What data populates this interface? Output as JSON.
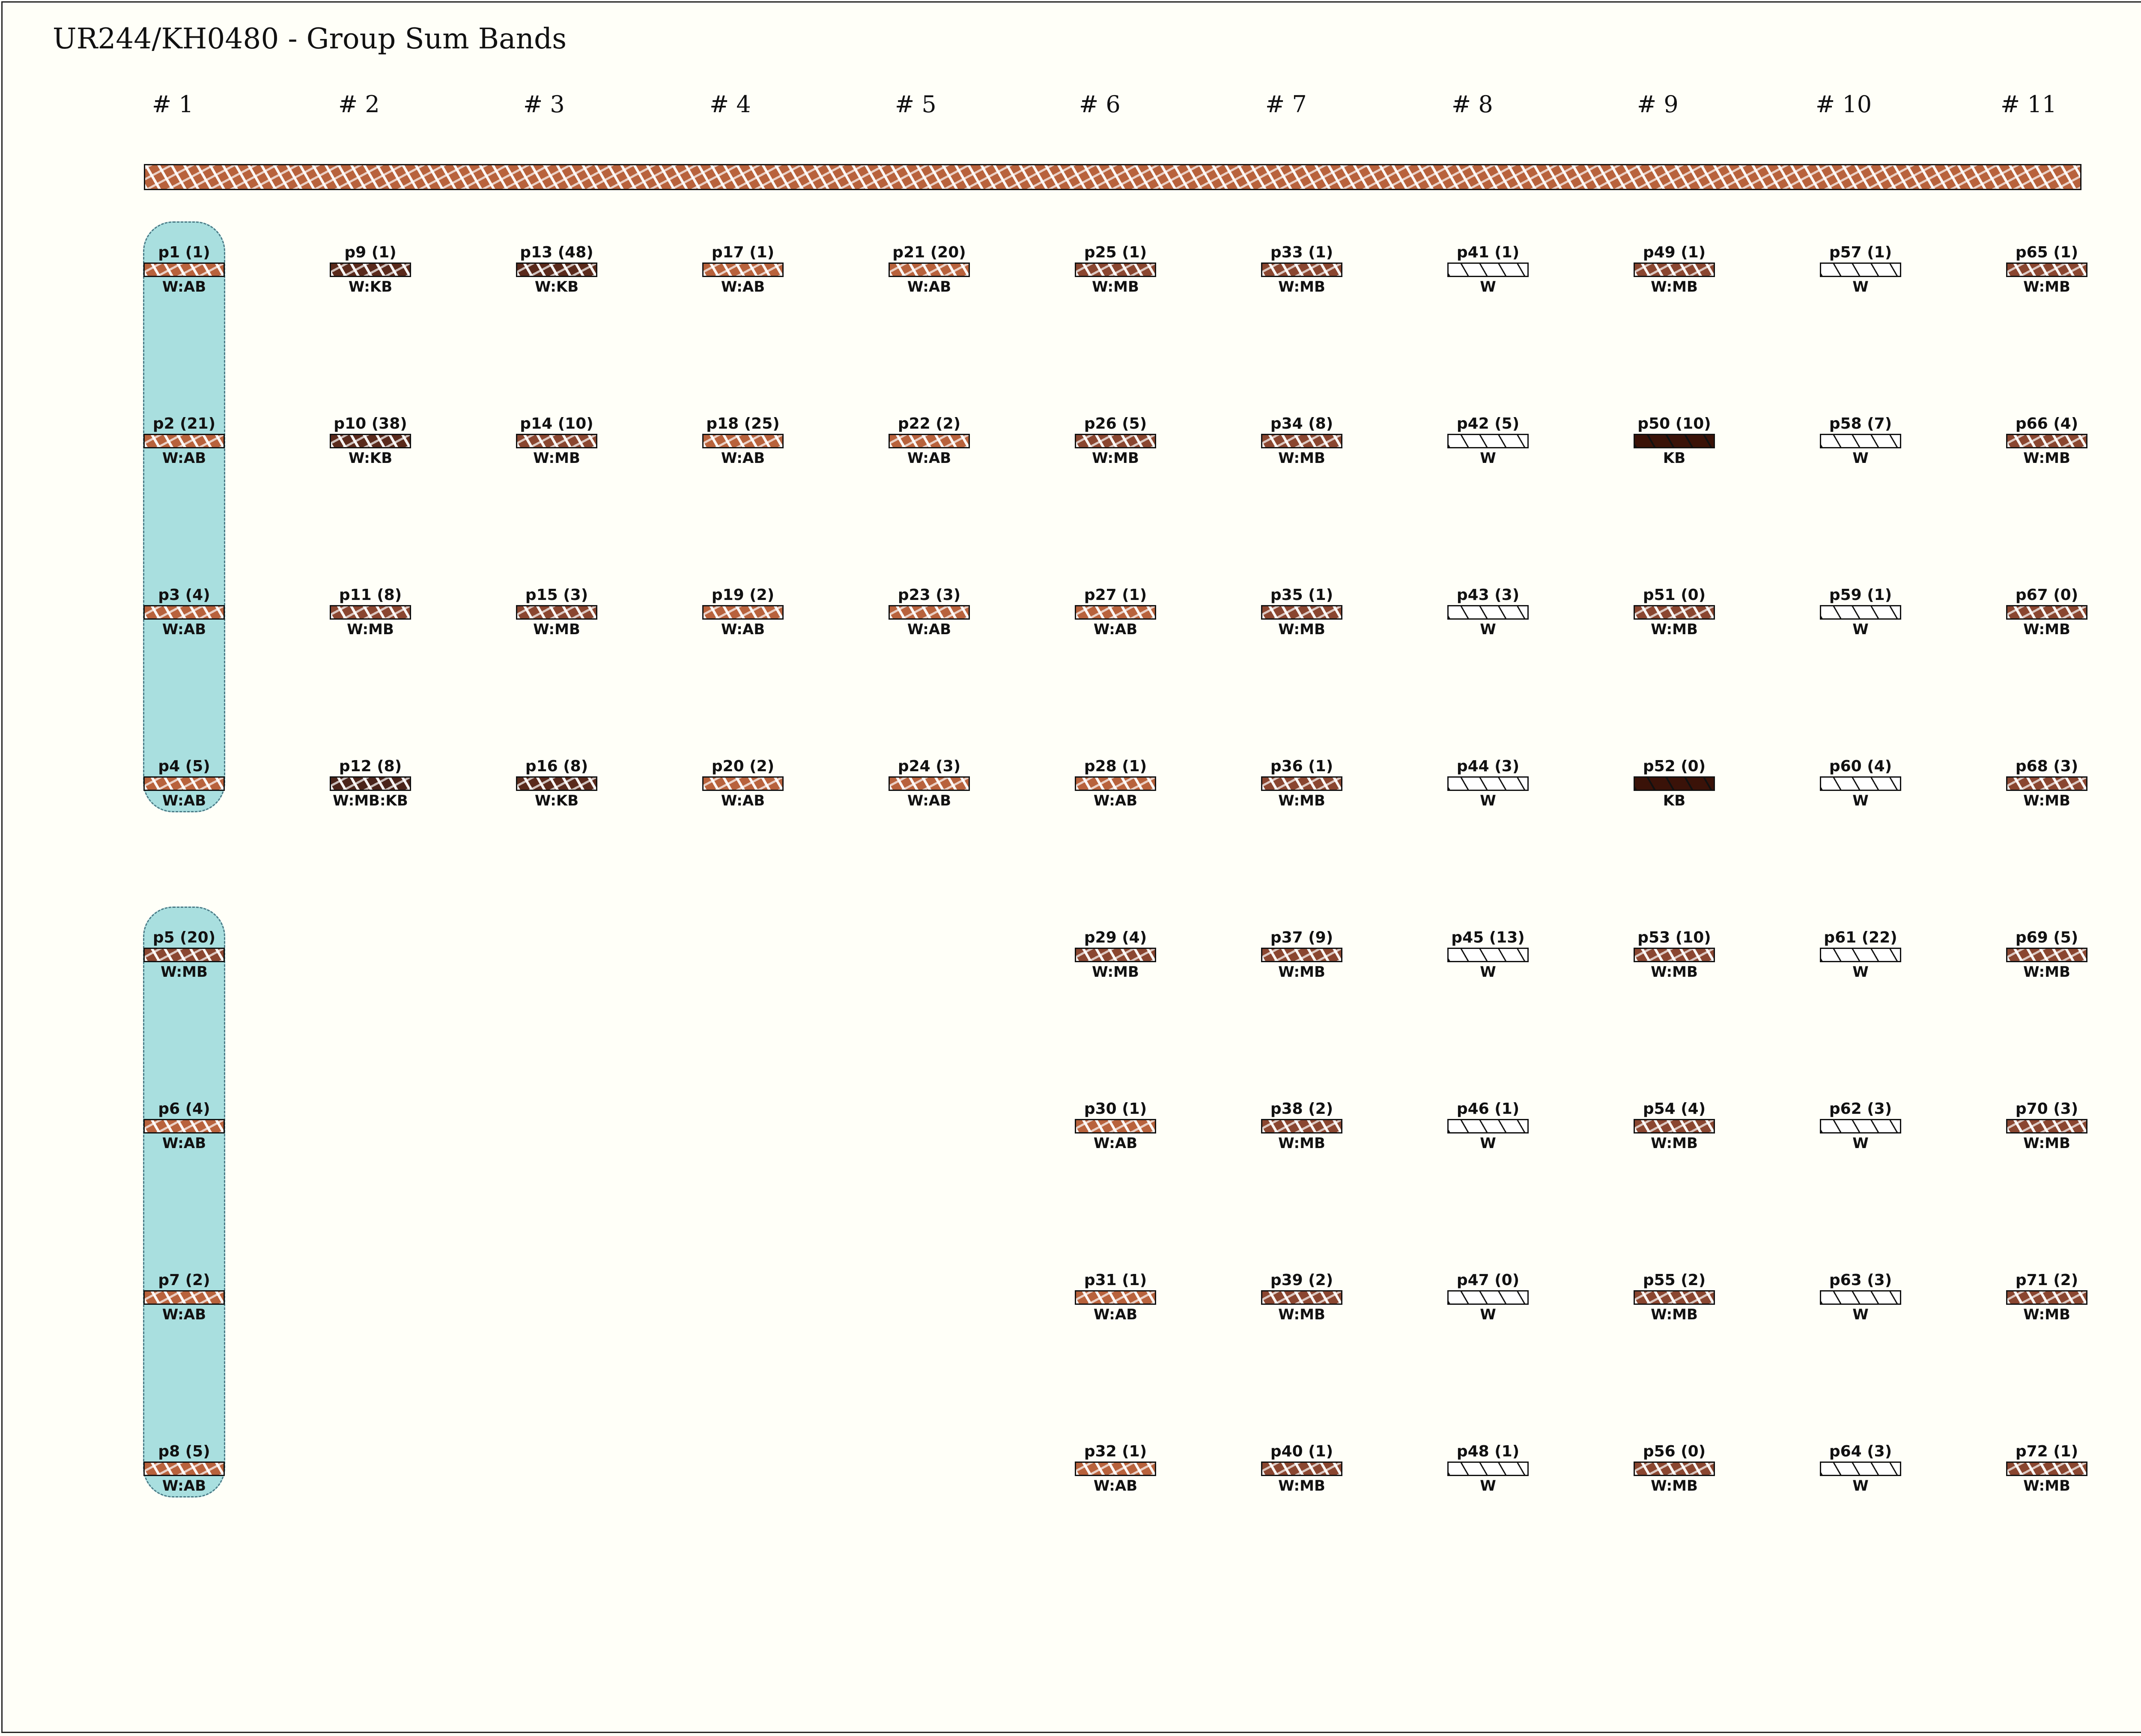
{
  "title": "UR244/KH0480 - Group Sum Bands",
  "columns": [
    "# 1",
    "# 2",
    "# 3",
    "# 4",
    "# 5",
    "# 6",
    "# 7",
    "# 8",
    "# 9",
    "# 10",
    "# 11"
  ],
  "grid": [
    [
      {
        "label": "p1 (1)",
        "code": "W:AB"
      },
      {
        "label": "p2 (21)",
        "code": "W:AB"
      },
      {
        "label": "p3 (4)",
        "code": "W:AB"
      },
      {
        "label": "p4 (5)",
        "code": "W:AB"
      },
      {
        "label": "p5 (20)",
        "code": "W:MB"
      },
      {
        "label": "p6 (4)",
        "code": "W:AB"
      },
      {
        "label": "p7 (2)",
        "code": "W:AB"
      },
      {
        "label": "p8 (5)",
        "code": "W:AB"
      }
    ],
    [
      {
        "label": "p9 (1)",
        "code": "W:KB"
      },
      {
        "label": "p10 (38)",
        "code": "W:KB"
      },
      {
        "label": "p11 (8)",
        "code": "W:MB"
      },
      {
        "label": "p12 (8)",
        "code": "W:MB:KB"
      }
    ],
    [
      {
        "label": "p13 (48)",
        "code": "W:KB"
      },
      {
        "label": "p14 (10)",
        "code": "W:MB"
      },
      {
        "label": "p15 (3)",
        "code": "W:MB"
      },
      {
        "label": "p16 (8)",
        "code": "W:KB"
      }
    ],
    [
      {
        "label": "p17 (1)",
        "code": "W:AB"
      },
      {
        "label": "p18 (25)",
        "code": "W:AB"
      },
      {
        "label": "p19 (2)",
        "code": "W:AB"
      },
      {
        "label": "p20 (2)",
        "code": "W:AB"
      }
    ],
    [
      {
        "label": "p21 (20)",
        "code": "W:AB"
      },
      {
        "label": "p22 (2)",
        "code": "W:AB"
      },
      {
        "label": "p23 (3)",
        "code": "W:AB"
      },
      {
        "label": "p24 (3)",
        "code": "W:AB"
      }
    ],
    [
      {
        "label": "p25 (1)",
        "code": "W:MB"
      },
      {
        "label": "p26 (5)",
        "code": "W:MB"
      },
      {
        "label": "p27 (1)",
        "code": "W:AB"
      },
      {
        "label": "p28 (1)",
        "code": "W:AB"
      },
      {
        "label": "p29 (4)",
        "code": "W:MB"
      },
      {
        "label": "p30 (1)",
        "code": "W:AB"
      },
      {
        "label": "p31 (1)",
        "code": "W:AB"
      },
      {
        "label": "p32 (1)",
        "code": "W:AB"
      }
    ],
    [
      {
        "label": "p33 (1)",
        "code": "W:MB"
      },
      {
        "label": "p34 (8)",
        "code": "W:MB"
      },
      {
        "label": "p35 (1)",
        "code": "W:MB"
      },
      {
        "label": "p36 (1)",
        "code": "W:MB"
      },
      {
        "label": "p37 (9)",
        "code": "W:MB"
      },
      {
        "label": "p38 (2)",
        "code": "W:MB"
      },
      {
        "label": "p39 (2)",
        "code": "W:MB"
      },
      {
        "label": "p40 (1)",
        "code": "W:MB"
      }
    ],
    [
      {
        "label": "p41 (1)",
        "code": "W"
      },
      {
        "label": "p42 (5)",
        "code": "W"
      },
      {
        "label": "p43 (3)",
        "code": "W"
      },
      {
        "label": "p44 (3)",
        "code": "W"
      },
      {
        "label": "p45 (13)",
        "code": "W"
      },
      {
        "label": "p46 (1)",
        "code": "W"
      },
      {
        "label": "p47 (0)",
        "code": "W"
      },
      {
        "label": "p48 (1)",
        "code": "W"
      }
    ],
    [
      {
        "label": "p49 (1)",
        "code": "W:MB"
      },
      {
        "label": "p50 (10)",
        "code": "KB"
      },
      {
        "label": "p51 (0)",
        "code": "W:MB"
      },
      {
        "label": "p52 (0)",
        "code": "KB"
      },
      {
        "label": "p53 (10)",
        "code": "W:MB"
      },
      {
        "label": "p54 (4)",
        "code": "W:MB"
      },
      {
        "label": "p55 (2)",
        "code": "W:MB"
      },
      {
        "label": "p56 (0)",
        "code": "W:MB"
      }
    ],
    [
      {
        "label": "p57 (1)",
        "code": "W"
      },
      {
        "label": "p58 (7)",
        "code": "W"
      },
      {
        "label": "p59 (1)",
        "code": "W"
      },
      {
        "label": "p60 (4)",
        "code": "W"
      },
      {
        "label": "p61 (22)",
        "code": "W"
      },
      {
        "label": "p62 (3)",
        "code": "W"
      },
      {
        "label": "p63 (3)",
        "code": "W"
      },
      {
        "label": "p64 (3)",
        "code": "W"
      }
    ],
    [
      {
        "label": "p65 (1)",
        "code": "W:MB"
      },
      {
        "label": "p66 (4)",
        "code": "W:MB"
      },
      {
        "label": "p67 (0)",
        "code": "W:MB"
      },
      {
        "label": "p68 (3)",
        "code": "W:MB"
      },
      {
        "label": "p69 (5)",
        "code": "W:MB"
      },
      {
        "label": "p70 (3)",
        "code": "W:MB"
      },
      {
        "label": "p71 (2)",
        "code": "W:MB"
      },
      {
        "label": "p72 (1)",
        "code": "W:MB"
      }
    ]
  ],
  "highlight_groups": [
    {
      "column": 1,
      "first_row": 1,
      "last_row": 4
    },
    {
      "column": 1,
      "first_row": 5,
      "last_row": 8
    }
  ]
}
